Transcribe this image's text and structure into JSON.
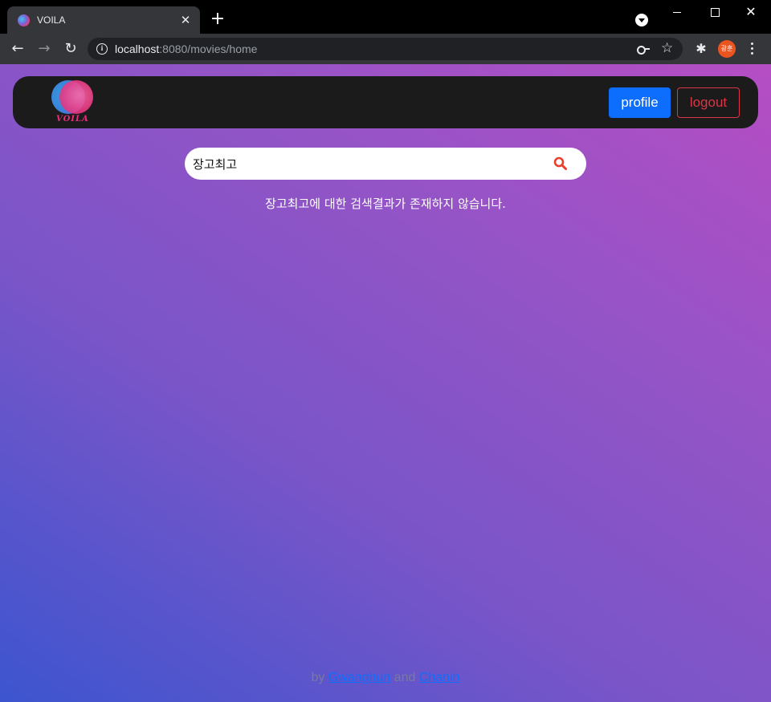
{
  "browser": {
    "tab_title": "VOILA",
    "tab_close": "✕",
    "new_tab": "+",
    "url_host": "localhost",
    "url_rest": ":8080/movies/home",
    "avatar_text": "광훈",
    "window_close": "✕"
  },
  "site": {
    "logo_text": "VOILA",
    "profile_label": "profile",
    "logout_label": "logout"
  },
  "search": {
    "value": "장고최고"
  },
  "result": {
    "message": "장고최고에 대한 검색결과가 존재하지 않습니다."
  },
  "footer": {
    "prefix": "by ",
    "author1": "Gwanghun",
    "conjunction": " and ",
    "author2": "Chanin"
  },
  "colors": {
    "primary_button": "#0d6efd",
    "logout_outline": "#dc3545",
    "search_icon": "#e8402c",
    "navbar_bg": "#1b1b1b"
  }
}
